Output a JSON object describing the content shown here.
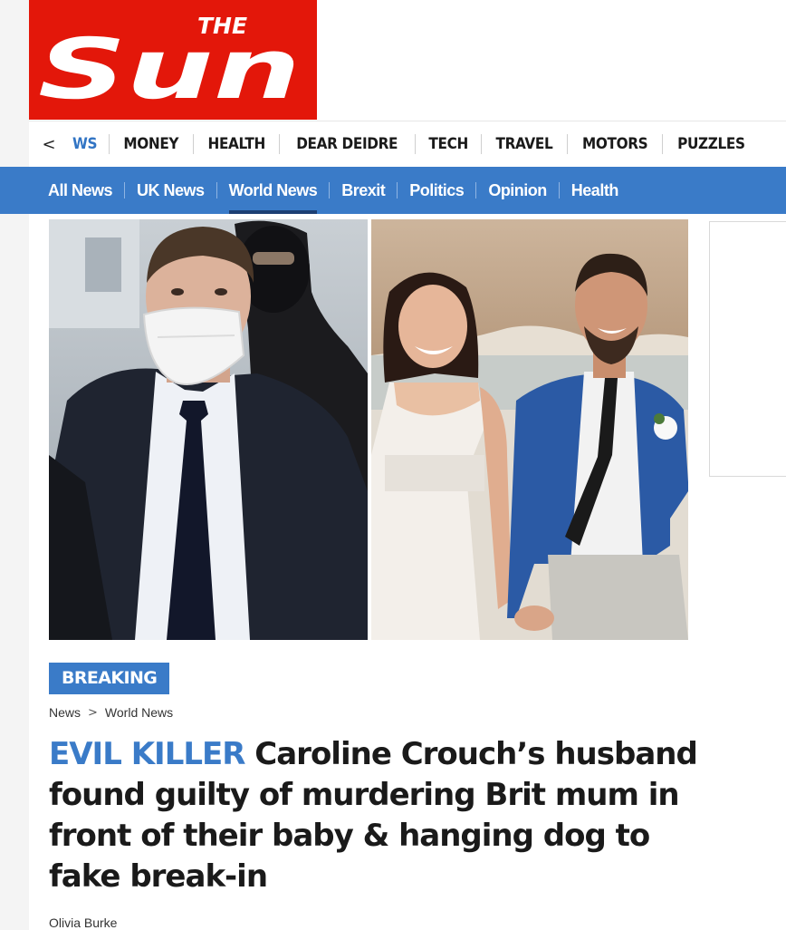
{
  "logo": {
    "small_text": "THE",
    "big_text": "Sun",
    "bg_color": "#e3170a"
  },
  "top_nav": {
    "back_icon": "chevron-left-icon",
    "back_glyph": "<",
    "items": [
      "WS",
      "MONEY",
      "HEALTH",
      "DEAR DEIDRE",
      "TECH",
      "TRAVEL",
      "MOTORS",
      "PUZZLES"
    ],
    "active_index": 0,
    "active_color": "#3174c4"
  },
  "sub_nav": {
    "bg_color": "#3a7bc8",
    "items": [
      "All News",
      "UK News",
      "World News",
      "Brexit",
      "Politics",
      "Opinion",
      "Health"
    ],
    "active_index": 2
  },
  "article": {
    "badge": "BREAKING",
    "breadcrumb": [
      "News",
      "World News"
    ],
    "breadcrumb_separator": ">",
    "kicker": "EVIL KILLER",
    "headline": "Caroline Crouch’s husband found guilty of murdering Brit mum in front of their baby & hanging dog to fake break-in",
    "author": "Olivia Burke"
  }
}
